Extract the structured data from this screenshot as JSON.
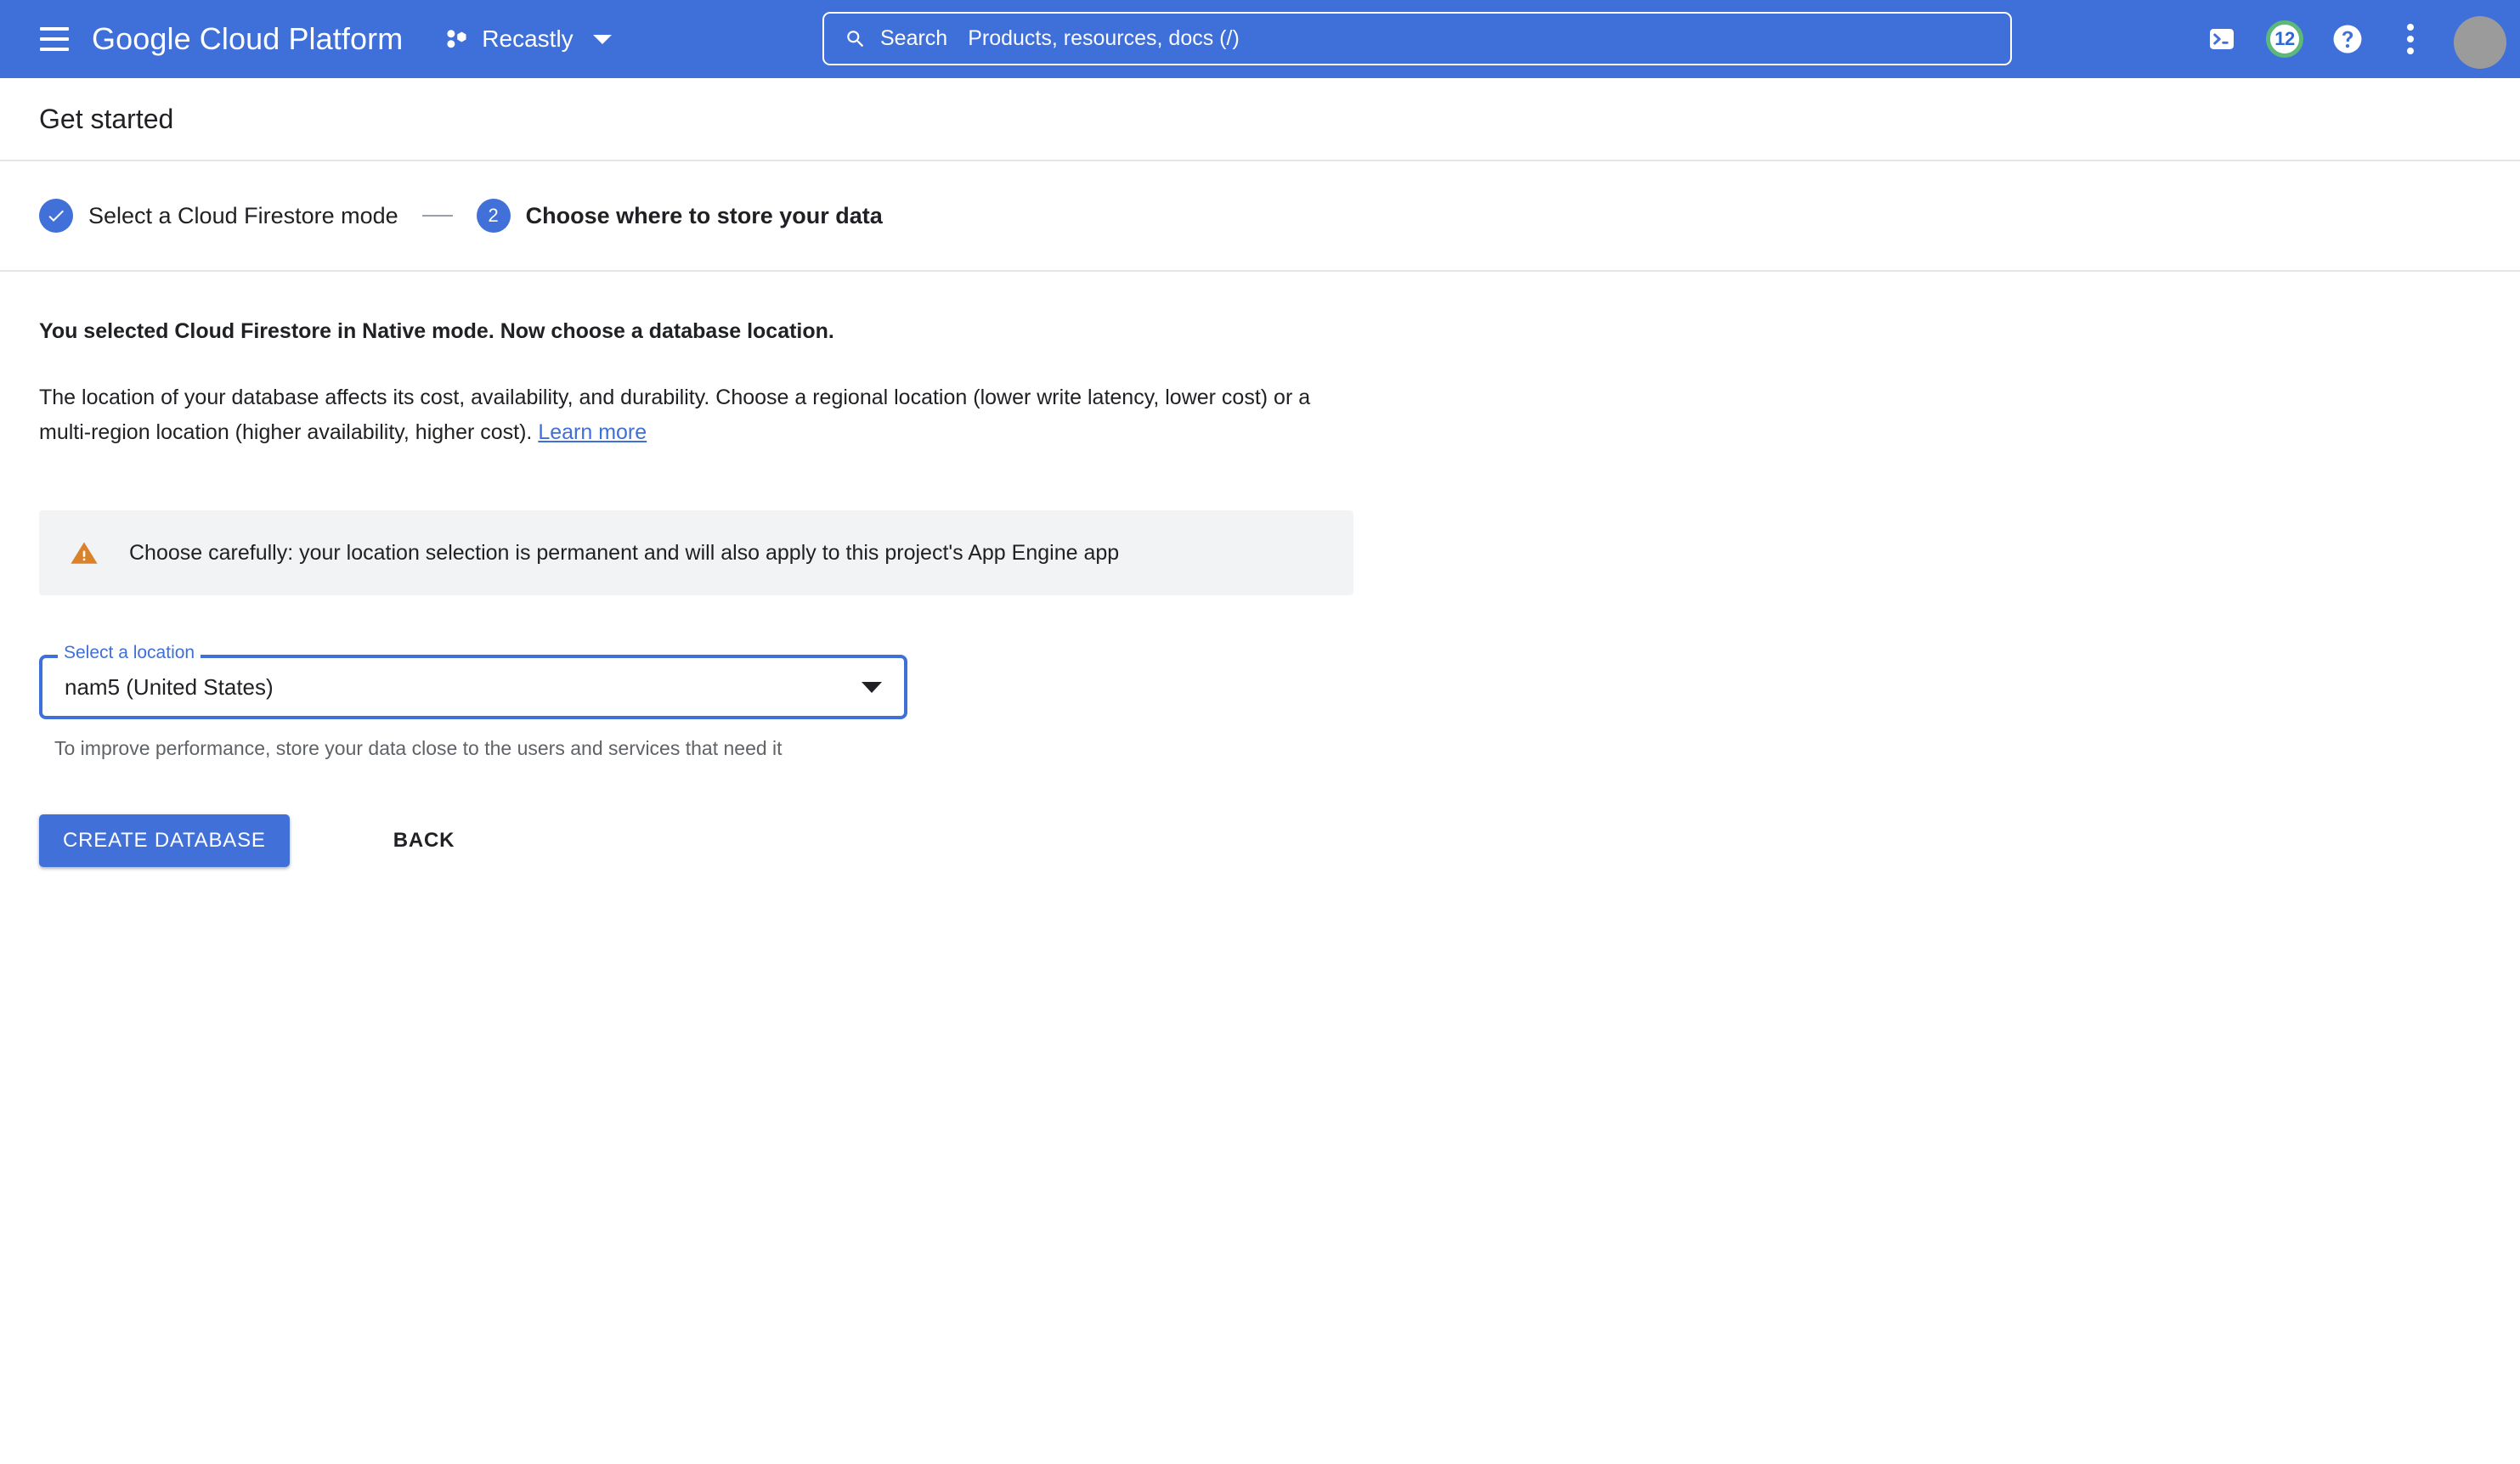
{
  "header": {
    "menu_icon": "hamburger-menu-icon",
    "brand": "Google Cloud Platform",
    "project": {
      "icon": "cloud-project-icon",
      "name": "Recastly",
      "caret_icon": "chevron-down-icon"
    },
    "search": {
      "icon": "search-icon",
      "label": "Search",
      "placeholder": "Products, resources, docs (/)"
    },
    "actions": {
      "cloud_shell_icon": "terminal-icon",
      "notifications_count": "12",
      "help_icon": "help-circle-icon",
      "more_icon": "kebab-menu-icon",
      "avatar_icon": "user-avatar"
    },
    "colors": {
      "bar_background": "#3f6fd8",
      "notification_ring": "#5cb97a",
      "avatar_fill": "#9b9b9b"
    }
  },
  "page": {
    "title": "Get started"
  },
  "stepper": {
    "steps": [
      {
        "indicator": "check",
        "number": "",
        "label": "Select a Cloud Firestore mode",
        "state": "complete"
      },
      {
        "indicator": "number",
        "number": "2",
        "label": "Choose where to store your data",
        "state": "active"
      }
    ],
    "connector": "—",
    "active_color": "#4070d8"
  },
  "main": {
    "lead": "You selected Cloud Firestore in Native mode. Now choose a database location.",
    "paragraph": "The location of your database affects its cost, availability, and durability. Choose a regional location (lower write latency, lower cost) or a multi-region location (higher availability, higher cost).",
    "learn_more": "Learn more",
    "warning": {
      "icon": "warning-triangle-icon",
      "text": "Choose carefully: your location selection is permanent and will also apply to this project's App Engine app",
      "background": "#f1f3f4",
      "icon_color": "#d9822b"
    },
    "location_field": {
      "label": "Select a location",
      "value": "nam5 (United States)",
      "caret_icon": "dropdown-caret-icon",
      "hint": "To improve performance, store your data close to the users and services that need it",
      "focus_color": "#3f6fd8"
    },
    "actions": {
      "primary_label": "CREATE DATABASE",
      "secondary_label": "BACK",
      "primary_color": "#4070d8"
    }
  }
}
